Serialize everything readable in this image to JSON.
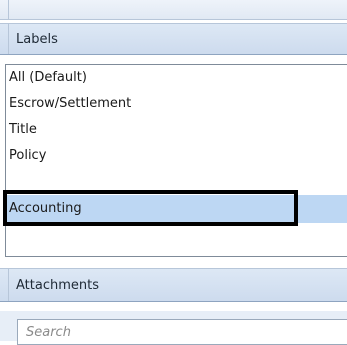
{
  "labels_panel": {
    "title": "Labels",
    "items": [
      {
        "label": "All  (Default)"
      },
      {
        "label": "Escrow/Settlement"
      },
      {
        "label": "Title"
      },
      {
        "label": "Policy"
      },
      {
        "label": "Accounting",
        "selected": true
      }
    ]
  },
  "attachments_panel": {
    "title": "Attachments",
    "search": {
      "placeholder": "Search",
      "value": ""
    }
  }
}
